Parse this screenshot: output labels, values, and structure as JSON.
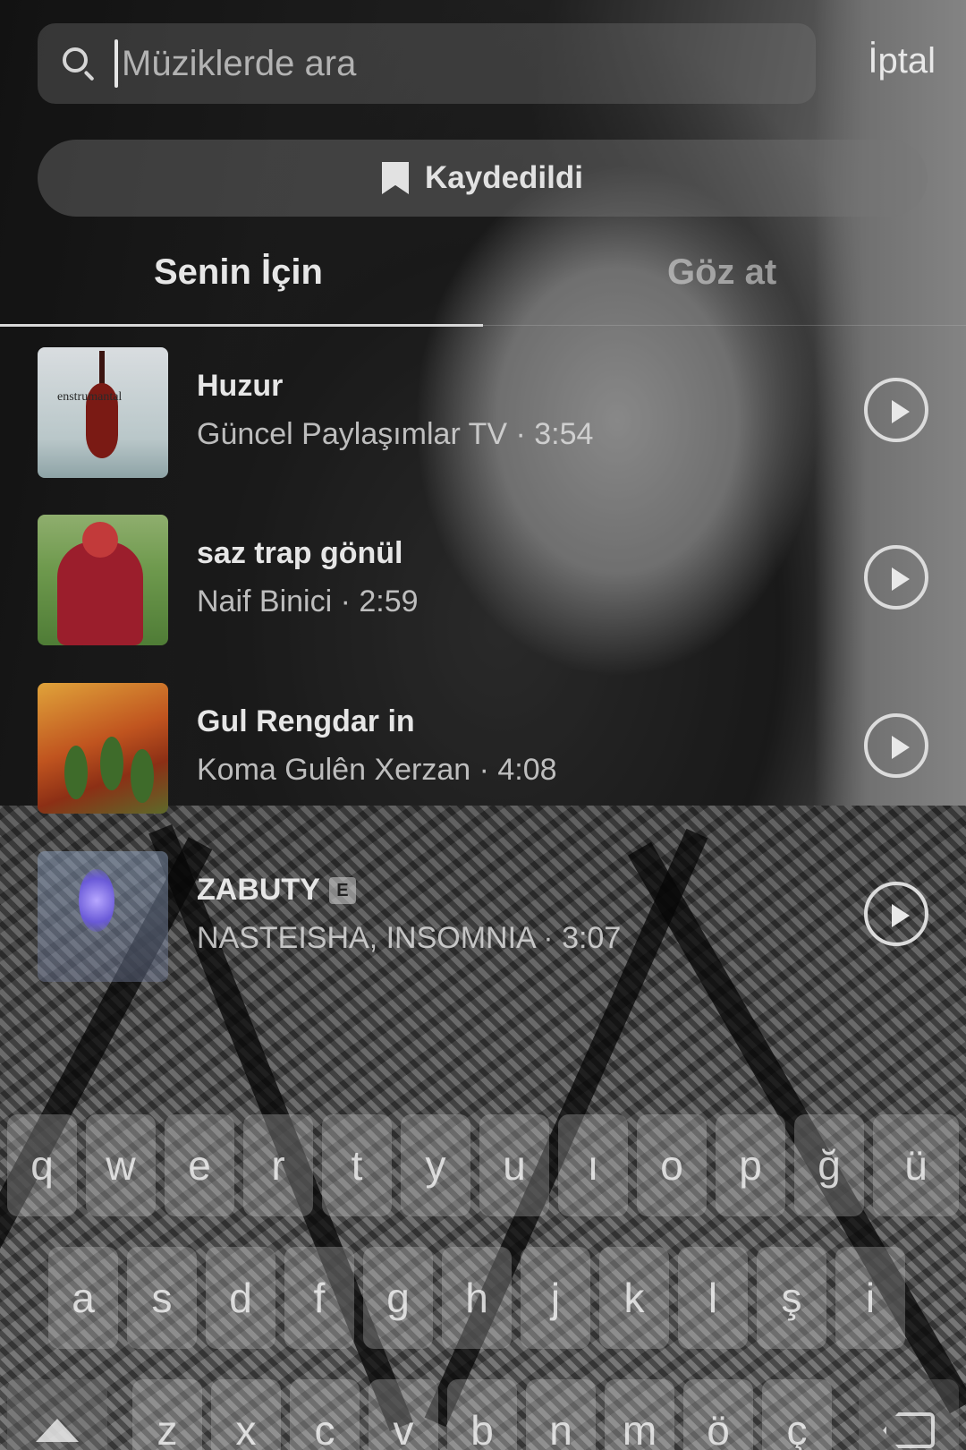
{
  "search": {
    "placeholder": "Müziklerde ara",
    "cancel_label": "İptal"
  },
  "saved_button": {
    "label": "Kaydedildi"
  },
  "tabs": [
    {
      "label": "Senin İçin",
      "active": true
    },
    {
      "label": "Göz at",
      "active": false
    }
  ],
  "songs": [
    {
      "title": "Huzur",
      "meta": "Güncel Paylaşımlar TV · 3:54",
      "art_label": "enstrumantal",
      "explicit": false
    },
    {
      "title": "saz trap gönül",
      "meta": "Naif Binici · 2:59",
      "explicit": false
    },
    {
      "title": "Gul Rengdar in",
      "meta": "Koma Gulên Xerzan · 4:08",
      "explicit": false
    },
    {
      "title": "ZABUTY",
      "meta": "NASTEISHA, INSOMNIA · 3:07",
      "explicit": true,
      "explicit_label": "E"
    }
  ],
  "keyboard": {
    "row1": [
      "q",
      "w",
      "e",
      "r",
      "t",
      "y",
      "u",
      "ı",
      "o",
      "p",
      "ğ",
      "ü"
    ],
    "row2": [
      "a",
      "s",
      "d",
      "f",
      "g",
      "h",
      "j",
      "k",
      "l",
      "ş",
      "i"
    ],
    "row3": [
      "z",
      "x",
      "c",
      "v",
      "b",
      "n",
      "m",
      "ö",
      "ç"
    ]
  },
  "colors": {
    "overlay": "#000000",
    "text_primary": "#e6e6e6",
    "control_fill": "#787878"
  }
}
